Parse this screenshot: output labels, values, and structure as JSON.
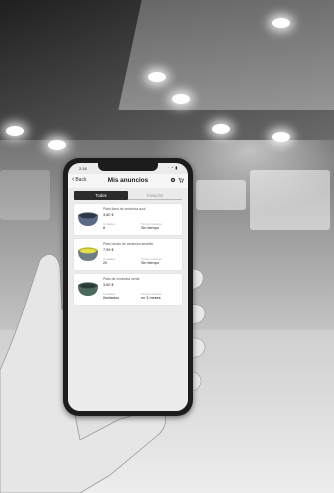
{
  "status_bar": {
    "time": "2:16",
    "icons": "ᐧ ◔ ▮"
  },
  "header": {
    "back_label": "Back",
    "title": "Mis anuncios",
    "icon_names": [
      "settings-icon",
      "cart-icon"
    ]
  },
  "tabs": [
    {
      "label": "Todos",
      "active": true
    },
    {
      "label": "Pasados",
      "active": false
    }
  ],
  "listings": [
    {
      "name": "Plato llano de cerámica azul",
      "price": "3,60 €",
      "left_label": "Unidades",
      "left_value": "8",
      "right_label": "Tiempo restante",
      "right_value": "Sin tiempo",
      "bowl_color": "#5a6a86"
    },
    {
      "name": "Plato hondo de cerámica amarillo",
      "price": "7,99 €",
      "left_label": "Unidades",
      "left_value": "20",
      "right_label": "Tiempo restante",
      "right_value": "Sin tiempo",
      "bowl_color": "#d8d43a"
    },
    {
      "name": "Plato de cerámica verde",
      "price": "3,60 €",
      "left_label": "Unidades",
      "left_value": "Ilimitados",
      "right_label": "Tiempo restante",
      "right_value": "en 3 meses",
      "bowl_color": "#4d6a5c"
    }
  ]
}
